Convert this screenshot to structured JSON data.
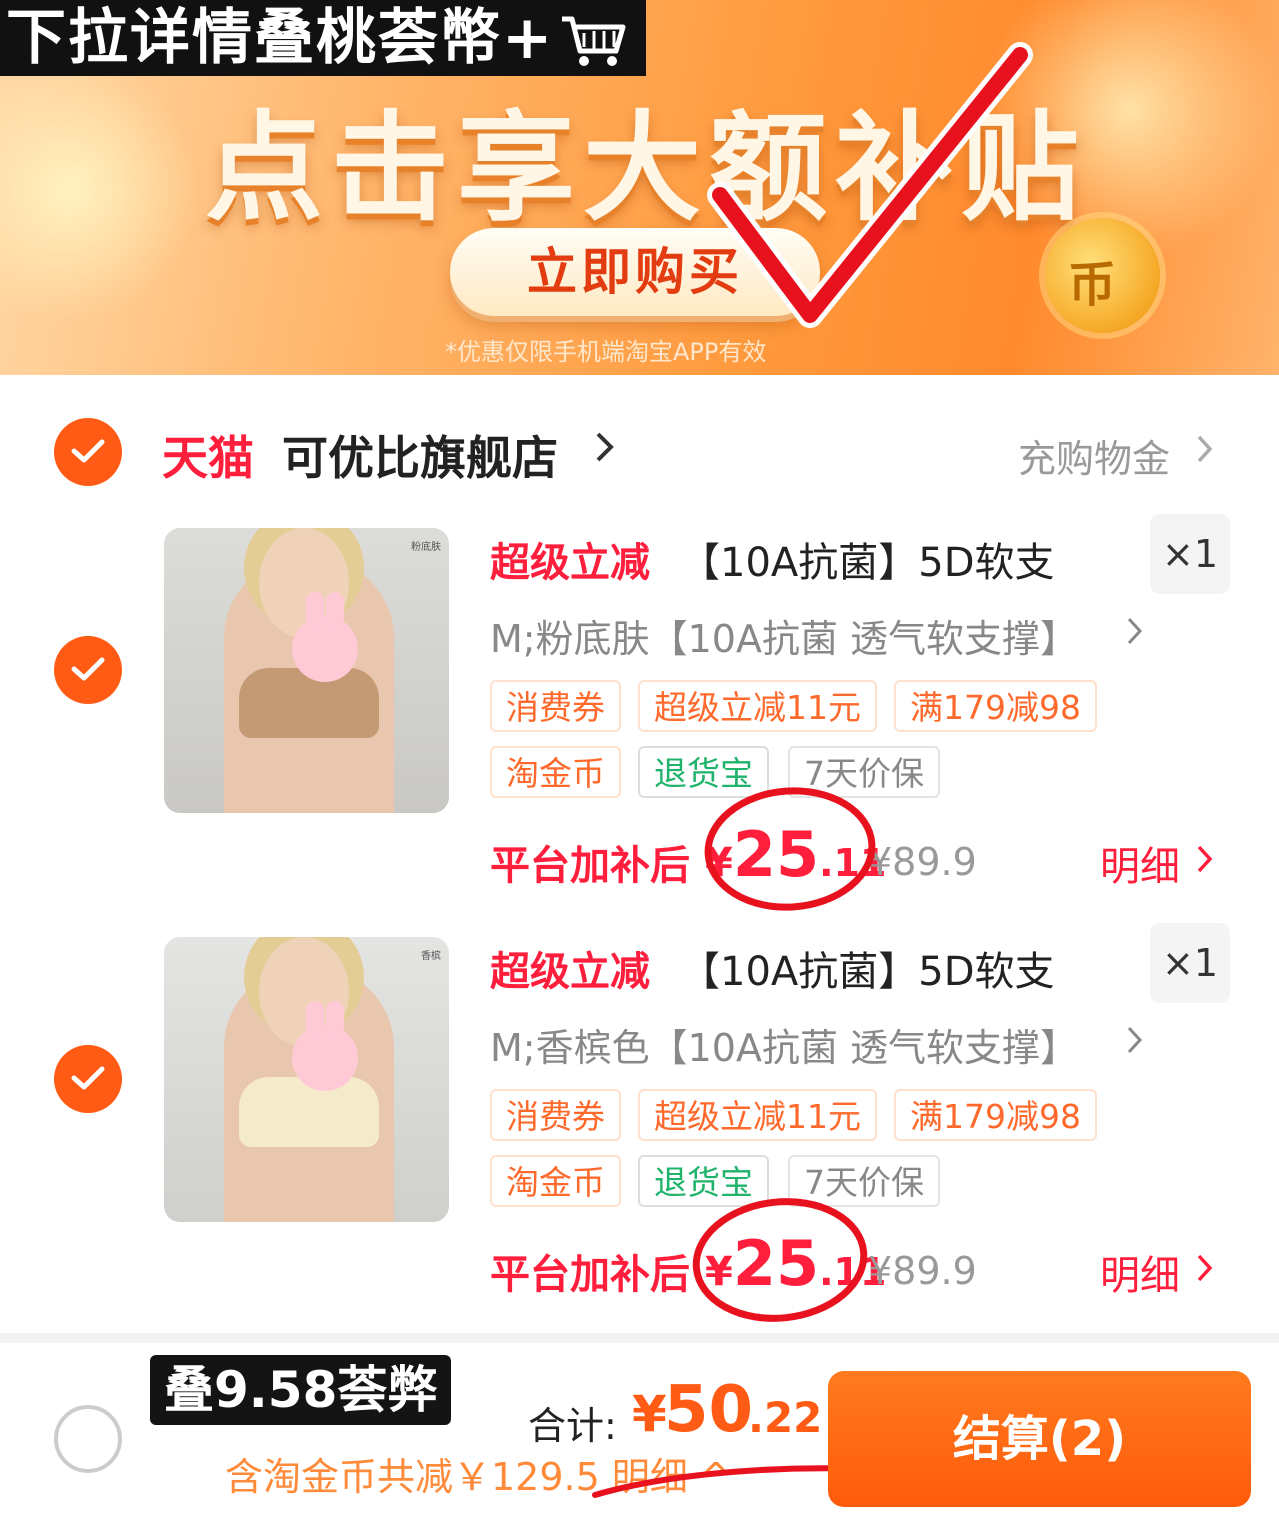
{
  "caption": "下拉详情叠桃荟幣+",
  "banner": {
    "headline": "点击享大额补贴",
    "buy_button": "立即购买",
    "fine_print": "*优惠仅限手机端淘宝APP有效"
  },
  "shop": {
    "platform": "天猫",
    "name": "可优比旗舰店",
    "cash_link": "充购物金"
  },
  "items": [
    {
      "badge": "超级立减",
      "title": "【10A抗菌】5D软支",
      "qty": "×1",
      "sku": "M;粉底肤【10A抗菌 透气软支撑】",
      "tags": [
        "消费券",
        "超级立减11元",
        "满179减98",
        "淘金币",
        "退货宝",
        "7天价保"
      ],
      "price_label": "平台加补后",
      "price_yen": "¥",
      "price_int": "25",
      "price_dec": ".11",
      "orig_price": "¥89.9",
      "detail": "明细",
      "image_tag": "粉底肤",
      "bra_color": "#c49a74"
    },
    {
      "badge": "超级立减",
      "title": "【10A抗菌】5D软支",
      "qty": "×1",
      "sku": "M;香槟色【10A抗菌 透气软支撑】",
      "tags": [
        "消费券",
        "超级立减11元",
        "满179减98",
        "淘金币",
        "退货宝",
        "7天价保"
      ],
      "price_label": "平台加补后",
      "price_yen": "¥",
      "price_int": "25",
      "price_dec": ".11",
      "orig_price": "¥89.9",
      "detail": "明细",
      "image_tag": "香槟",
      "bra_color": "#f5eac9"
    }
  ],
  "bottom": {
    "stack_badge": "叠9.58荟弊",
    "total_label": "合计:",
    "total_yen": "¥",
    "total_int": "50",
    "total_dec": ".22",
    "saving": "含淘金币共减￥129.5 明细 ^",
    "checkout": "结算(2)"
  },
  "colors": {
    "accent": "#ff5b14",
    "price_red": "#ff1f3d",
    "marker_red": "#e8121f"
  }
}
